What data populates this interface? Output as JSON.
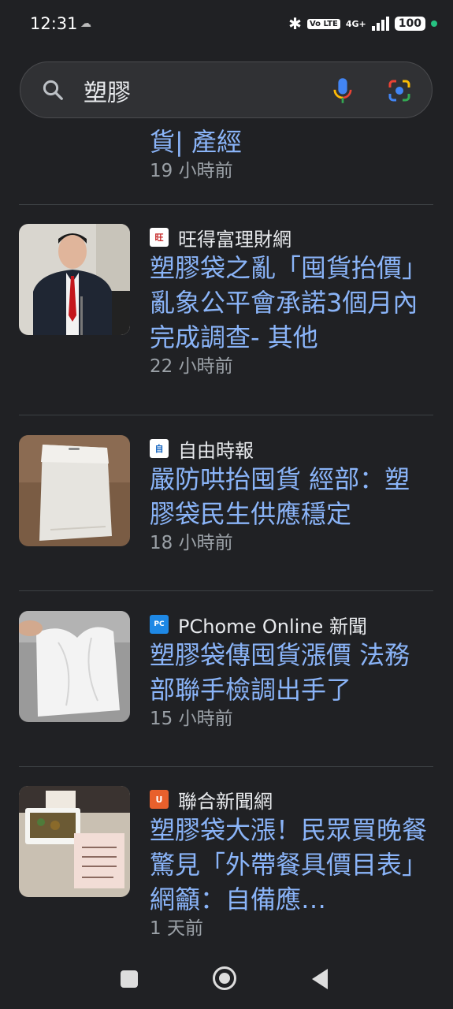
{
  "status_bar": {
    "time": "12:31",
    "small_icon": "☁",
    "volte": "Vo LTE",
    "network": "4G+",
    "battery": "100"
  },
  "search": {
    "query": "塑膠"
  },
  "partial_result": {
    "title_tail": "貨| 產經",
    "time": "19 小時前"
  },
  "results": [
    {
      "source": "旺得富理財網",
      "title": "塑膠袋之亂「囤貨抬價」亂象公平會承諾3個月內完成調查- 其他",
      "time": "22 小時前",
      "favicon_color": "#c62828",
      "favicon_text": "旺"
    },
    {
      "source": "自由時報",
      "title": "嚴防哄抬囤貨 經部：塑膠袋民生供應穩定",
      "time": "18 小時前",
      "favicon_color": "#1565c0",
      "favicon_text": "自"
    },
    {
      "source": "PChome Online 新聞",
      "title": "塑膠袋傳囤貨漲價 法務部聯手檢調出手了",
      "time": "15 小時前",
      "favicon_color": "#1e88e5",
      "favicon_text": "PC"
    },
    {
      "source": "聯合新聞網",
      "title": "塑膠袋大漲！民眾買晚餐驚見「外帶餐具價目表」 網籲：自備應…",
      "time": "1 天前",
      "favicon_color": "#e8602c",
      "favicon_text": "U"
    }
  ]
}
